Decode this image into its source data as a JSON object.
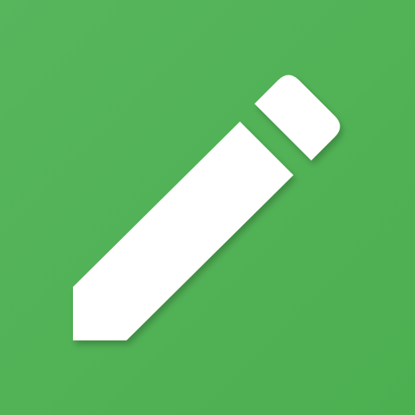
{
  "icon": {
    "name": "pencil-icon",
    "background_color": "#4CAF50",
    "background_highlight": "#57B55C",
    "foreground_color": "#FFFFFF"
  }
}
